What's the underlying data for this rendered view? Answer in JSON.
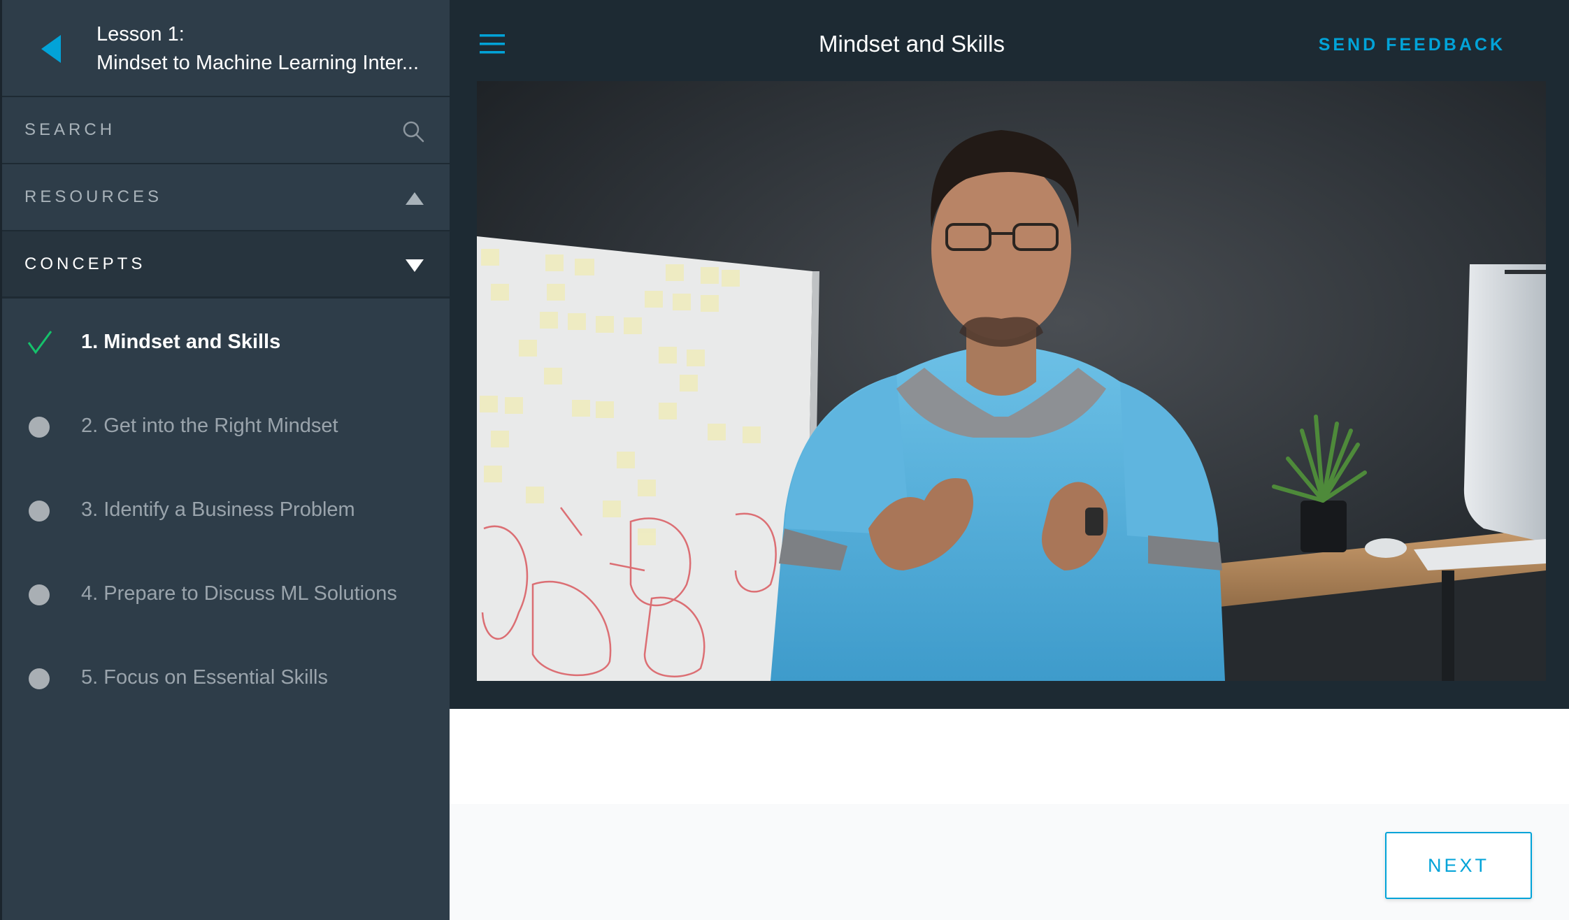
{
  "sidebar": {
    "lesson_number": "Lesson 1:",
    "lesson_title": "Mindset to Machine Learning Inter...",
    "search_label": "SEARCH",
    "resources_label": "RESOURCES",
    "concepts_label": "CONCEPTS",
    "concepts": [
      {
        "label": "1. Mindset and Skills",
        "status": "completed"
      },
      {
        "label": "2. Get into the Right Mindset",
        "status": "not-started"
      },
      {
        "label": "3. Identify a Business Problem",
        "status": "not-started"
      },
      {
        "label": "4. Prepare to Discuss ML Solutions",
        "status": "not-started"
      },
      {
        "label": "5. Focus on Essential Skills",
        "status": "not-started"
      }
    ]
  },
  "header": {
    "title": "Mindset and Skills",
    "feedback_label": "SEND FEEDBACK"
  },
  "footer": {
    "next_label": "NEXT"
  },
  "colors": {
    "accent": "#02a3d8",
    "check": "#15c26b",
    "sidebar_bg": "#2e3d49",
    "topbar_bg": "#1d2a33"
  },
  "icons": {
    "back": "back-arrow-icon",
    "menu": "hamburger-menu-icon",
    "search": "search-icon",
    "resources_toggle": "caret-up-icon",
    "concepts_toggle": "caret-down-icon",
    "completed": "checkmark-icon",
    "not_started": "circle-dot-icon"
  }
}
